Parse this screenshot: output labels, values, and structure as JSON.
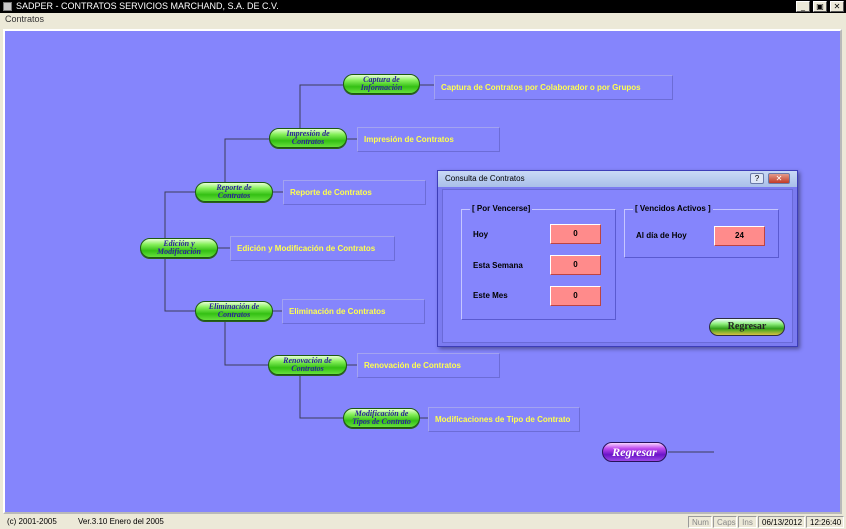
{
  "window": {
    "title": "SADPER - CONTRATOS   SERVICIOS MARCHAND, S.A. DE C.V.",
    "controls": {
      "minimize": "_",
      "maximize": "▣",
      "close": "✕"
    }
  },
  "menu": {
    "item": "Contratos"
  },
  "tree": {
    "root": {
      "label": "Edición y Modificación",
      "desc": "Edición y Modificación de Contratos"
    },
    "captura": {
      "label": "Captura de Información",
      "desc": "Captura de Contratos por Colaborador o por Grupos"
    },
    "impresion": {
      "label": "Impresión de Contratos",
      "desc": "Impresión de Contratos"
    },
    "reporte": {
      "label": "Reporte de Contratos",
      "desc": "Reporte de Contratos"
    },
    "eliminacion": {
      "label": "Eliminación de Contratos",
      "desc": "Eliminación de Contratos"
    },
    "renovacion": {
      "label": "Renovación de Contratos",
      "desc": "Renovación de Contratos"
    },
    "modificacion": {
      "label": "Modificación de Tipos de Contrato",
      "desc": "Modificaciones de Tipo de Contrato"
    }
  },
  "main_button": {
    "label": "Regresar"
  },
  "dialog": {
    "title": "Consulta de Contratos",
    "help": "?",
    "close": "✕",
    "por_vencerse": {
      "title": "[ Por Vencerse]",
      "rows": [
        {
          "label": "Hoy",
          "value": "0"
        },
        {
          "label": "Esta Semana",
          "value": "0"
        },
        {
          "label": "Este Mes",
          "value": "0"
        }
      ]
    },
    "vencidos": {
      "title": "[ Vencidos Activos ]",
      "label": "Al día de Hoy",
      "value": "24"
    },
    "regresar": "Regresar"
  },
  "status": {
    "copyright": "(c) 2001-2005",
    "version": "Ver.3.10  Enero del 2005",
    "num": "Num",
    "caps": "Caps",
    "ins": "Ins",
    "date": "06/13/2012",
    "time": "12:26:40"
  },
  "colors": {
    "background": "#8585fc",
    "node_green": "#34c014",
    "node_text": "#2a1f9a",
    "desc_text": "#ffff4f",
    "value_box": "#ff8b8b",
    "regresar_purple": "#6a14c8"
  }
}
